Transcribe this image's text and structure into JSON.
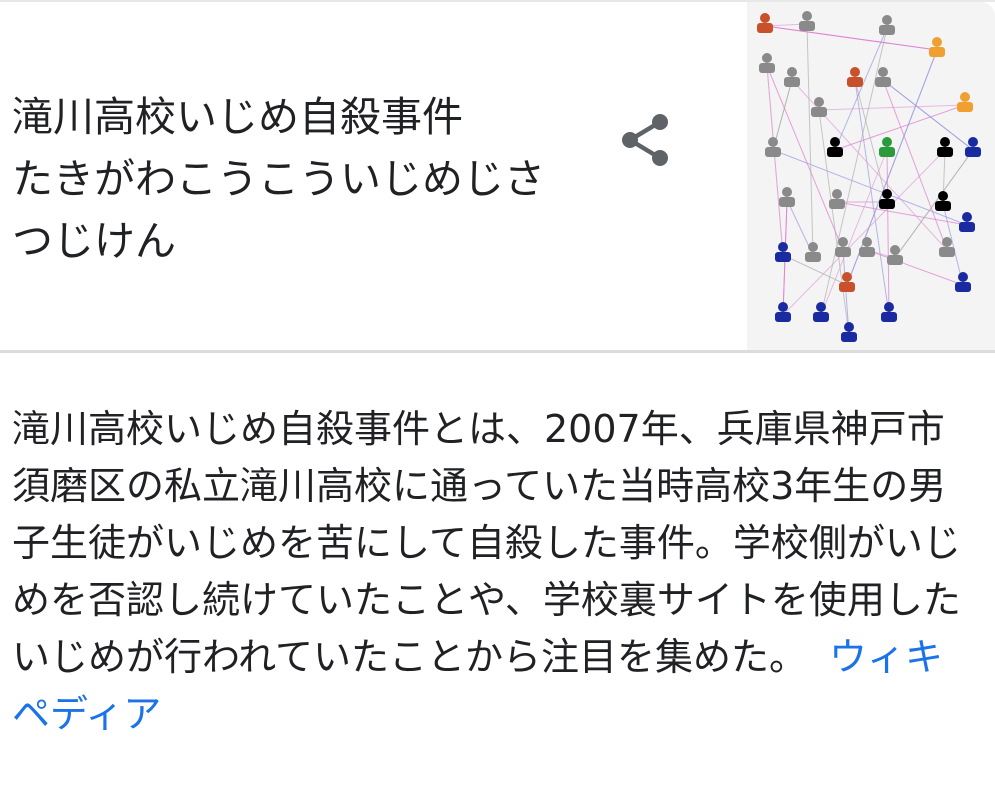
{
  "entity": {
    "title": "滝川高校いじめ自殺事件",
    "reading": "たきがわこうこういじめじさつじけん",
    "share_icon": "share-icon",
    "thumbnail_icon": "relationship-diagram-thumbnail"
  },
  "description": {
    "text": "滝川高校いじめ自殺事件とは、2007年、兵庫県神戸市須磨区の私立滝川高校に通っていた当時高校3年生の男子生徒がいじめを苦にして自殺した事件。学校側がいじめを否認し続けていたことや、学校裏サイトを使用したいじめが行われていたことから注目を集めた。",
    "source_label": "ウィキペディア"
  },
  "colors": {
    "link": "#1a73e8",
    "text": "#202124",
    "divider": "#dcdcdc",
    "icon": "#5f6368"
  }
}
